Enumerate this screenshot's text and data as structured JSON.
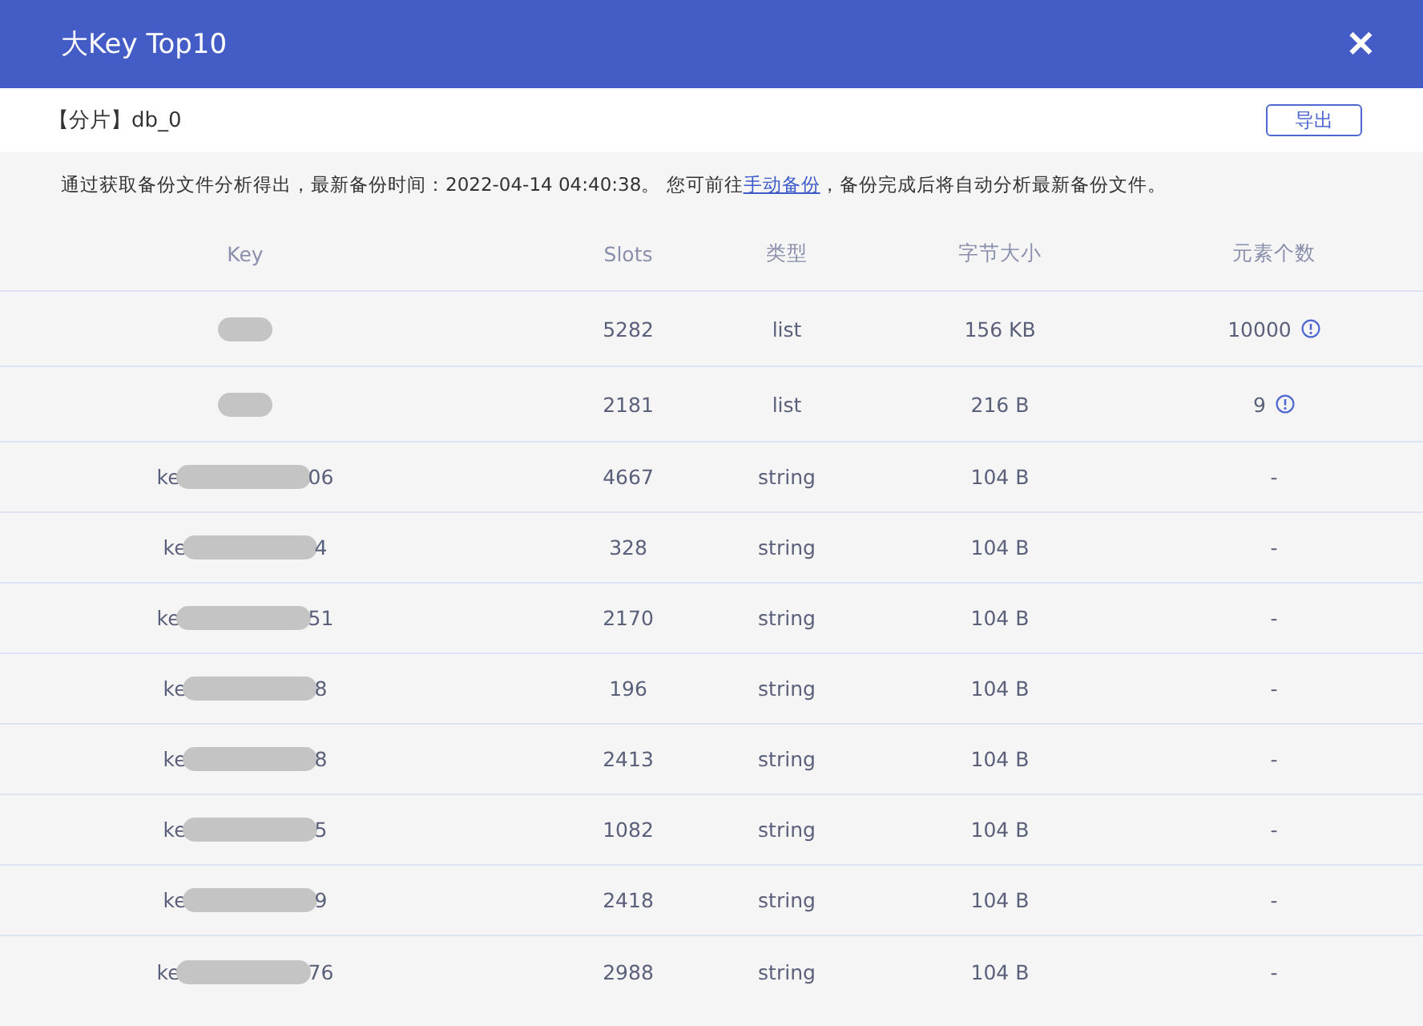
{
  "dialog": {
    "title": "大Key Top10",
    "close": "✕"
  },
  "toolbar": {
    "shard": "【分片】db_0",
    "export_button": "导出"
  },
  "notice": {
    "before": "通过获取备份文件分析得出，最新备份时间：2022-04-14 04:40:38。 您可前往",
    "link": "手动备份",
    "after": "，备份完成后将自动分析最新备份文件。"
  },
  "table": {
    "columns": [
      "Key",
      "Slots",
      "类型",
      "字节大小",
      "元素个数"
    ],
    "rows": [
      {
        "key": {
          "redacted": true
        },
        "slots": "5282",
        "type": "list",
        "size": "156 KB",
        "elements": "10000",
        "warning": true
      },
      {
        "key": {
          "redacted": true
        },
        "slots": "2181",
        "type": "list",
        "size": "216 B",
        "elements": "9",
        "warning": true
      },
      {
        "key": {
          "prefix": "ke",
          "suffix": "06",
          "redacted": true
        },
        "slots": "4667",
        "type": "string",
        "size": "104 B",
        "elements": "-",
        "warning": false
      },
      {
        "key": {
          "prefix": "ke",
          "suffix": "4",
          "redacted": true
        },
        "slots": "328",
        "type": "string",
        "size": "104 B",
        "elements": "-",
        "warning": false
      },
      {
        "key": {
          "prefix": "ke",
          "suffix": "51",
          "redacted": true
        },
        "slots": "2170",
        "type": "string",
        "size": "104 B",
        "elements": "-",
        "warning": false
      },
      {
        "key": {
          "prefix": "ke",
          "suffix": "8",
          "redacted": true
        },
        "slots": "196",
        "type": "string",
        "size": "104 B",
        "elements": "-",
        "warning": false
      },
      {
        "key": {
          "prefix": "ke",
          "suffix": "8",
          "redacted": true
        },
        "slots": "2413",
        "type": "string",
        "size": "104 B",
        "elements": "-",
        "warning": false
      },
      {
        "key": {
          "prefix": "ke",
          "suffix": "5",
          "redacted": true
        },
        "slots": "1082",
        "type": "string",
        "size": "104 B",
        "elements": "-",
        "warning": false
      },
      {
        "key": {
          "prefix": "ke",
          "suffix": "9",
          "redacted": true
        },
        "slots": "2418",
        "type": "string",
        "size": "104 B",
        "elements": "-",
        "warning": false
      },
      {
        "key": {
          "prefix": "ke",
          "suffix": "76",
          "redacted": true
        },
        "slots": "2988",
        "type": "string",
        "size": "104 B",
        "elements": "-",
        "warning": false
      }
    ]
  }
}
